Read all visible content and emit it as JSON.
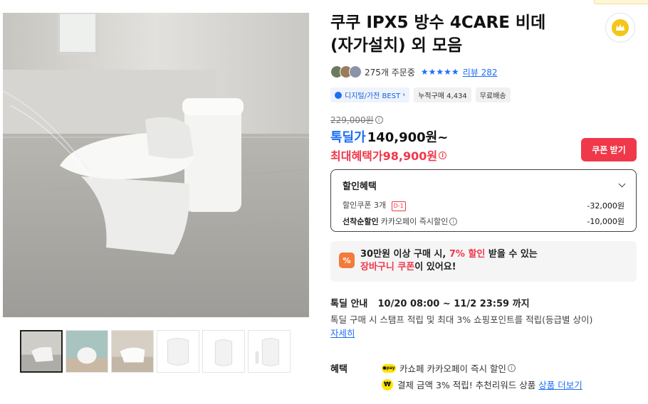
{
  "product": {
    "title": "쿠쿠 IPX5 방수 4CARE 비데 (자가설치) 외 모음",
    "order_count": "275개 주문중",
    "stars": "★★★★★",
    "review_link": "리뷰 282"
  },
  "badges": [
    {
      "label": "디지털/가전 BEST",
      "icon": "category-icon"
    },
    {
      "label": "누적구매 4,434"
    },
    {
      "label": "무료배송"
    }
  ],
  "price": {
    "original": "229,000원",
    "sale_label": "톡딜가",
    "sale_price": "140,900원~",
    "max_benefit": "최대혜택가98,900원",
    "coupon_button": "쿠폰 받기",
    "info_glyph": "i"
  },
  "discount": {
    "title": "할인혜택",
    "coupon_label": "할인쿠폰 3개",
    "coupon_tag": "D-1",
    "coupon_value": "-32,000원",
    "first_bold": "선착순할인",
    "first_label": "카카오페이 즉시할인",
    "first_value": "-10,000원"
  },
  "promo": {
    "icon_text": "%",
    "line1_a": "30만원 이상 구매 시, ",
    "line1_red": "7% 할인",
    "line1_b": " 받을 수 있는",
    "line2_red": "장바구니 쿠폰",
    "line2_b": "이 있어요!"
  },
  "deal": {
    "label": "톡딜 안내",
    "period": "10/20 08:00 ~ 11/2 23:59 까지",
    "desc": "톡딜 구매 시 스탬프 적립 및 최대 3% 쇼핑포인트를 적립(등급별 상이)",
    "more": "자세히"
  },
  "benefit": {
    "label": "혜택",
    "pay_chip": "●pay",
    "row1": "카쇼페 카카오페이 즉시 할인",
    "won_chip": "₩",
    "row2": "결제 금액 3% 적립! 추천리워드 상품",
    "row2_link": "상품 더보기"
  },
  "colors": {
    "accent_blue": "#1e6ef5",
    "accent_red": "#f0384b",
    "promo_orange": "#f47a3a",
    "kakao_yellow": "#ffe300"
  }
}
